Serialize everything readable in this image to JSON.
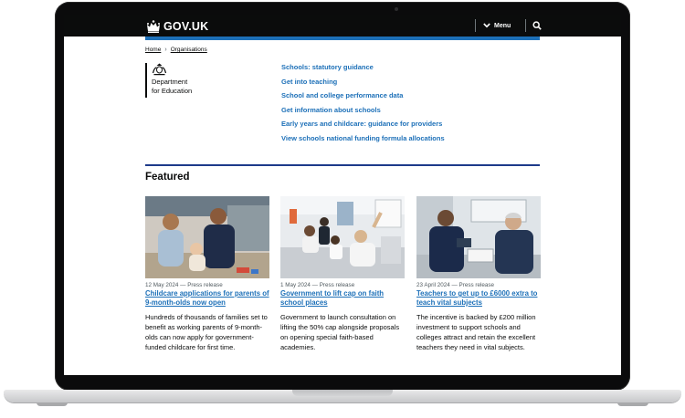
{
  "header": {
    "logo_text": "GOV.UK",
    "menu_label": "Menu",
    "crown_icon": "crown-icon",
    "search_icon": "search-icon"
  },
  "breadcrumb": [
    "Home",
    "Organisations"
  ],
  "organisation": {
    "line1": "Department",
    "line2": "for Education",
    "crest_icon": "royal-crest-icon"
  },
  "quick_links": [
    "Schools: statutory guidance",
    "Get into teaching",
    "School and college performance data",
    "Get information about schools",
    "Early years and childcare: guidance for providers",
    "View schools national funding formula allocations"
  ],
  "featured": {
    "heading": "Featured",
    "items": [
      {
        "meta": "12 May 2024 — Press release",
        "title": "Childcare applications for parents of 9-month-olds now open",
        "description": "Hundreds of thousands of families set to benefit as working parents of 9-month-olds can now apply for government-funded childcare for first time."
      },
      {
        "meta": "1 May 2024 — Press release",
        "title": "Government to lift cap on faith school places",
        "description": "Government to launch consultation on lifting the 50% cap alongside proposals on opening special faith-based academies."
      },
      {
        "meta": "23 April 2024 — Press release",
        "title": "Teachers to get up to £6000 extra to teach vital subjects",
        "description": "The incentive is backed by £200 million investment to support schools and colleges attract and retain the excellent teachers they need in vital subjects."
      }
    ]
  },
  "colors": {
    "link": "#1d70b8",
    "header_bg": "#0b0c0c",
    "rule": "#1d3a8a"
  }
}
